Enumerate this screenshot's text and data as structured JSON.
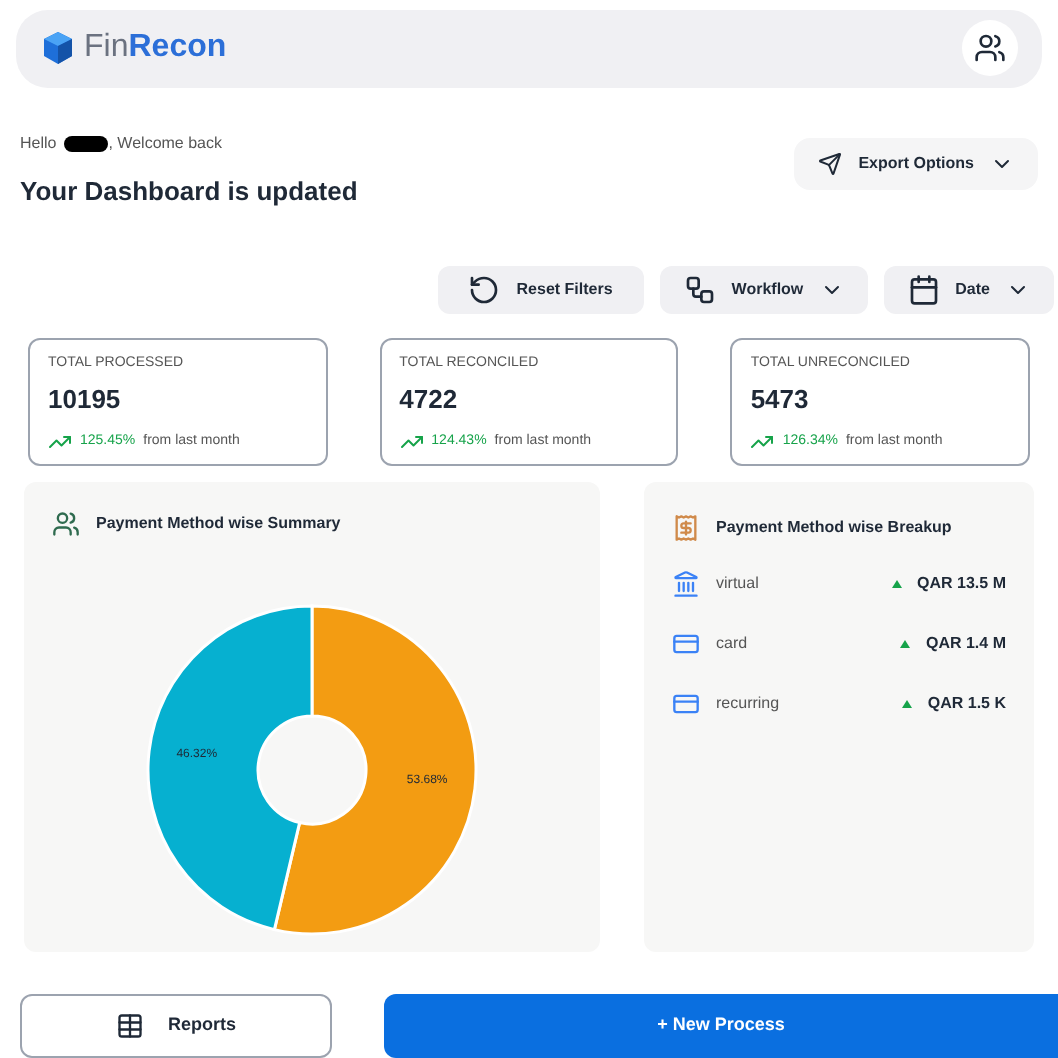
{
  "header": {
    "logo_prefix": "Fin",
    "logo_suffix": "Recon"
  },
  "greeting": {
    "prefix": "Hello",
    "suffix": ", Welcome back",
    "title": "Your Dashboard is updated"
  },
  "export_button": {
    "label": "Export Options"
  },
  "filters": [
    {
      "kind": "reset",
      "label": "Reset Filters"
    },
    {
      "kind": "workflow",
      "label": "Workflow"
    },
    {
      "kind": "date",
      "label": "Date"
    }
  ],
  "stats": [
    {
      "label": "TOTAL PROCESSED",
      "value": "10195",
      "change": "125.45%",
      "suffix": "from last month"
    },
    {
      "label": "TOTAL RECONCILED",
      "value": "4722",
      "change": "124.43%",
      "suffix": "from last month"
    },
    {
      "label": "TOTAL UNRECONCILED",
      "value": "5473",
      "change": "126.34%",
      "suffix": "from last month"
    }
  ],
  "summary": {
    "title": "Payment Method wise Summary",
    "chart_data": {
      "type": "donut",
      "values": [
        53.68,
        46.32
      ],
      "value_labels": [
        "53.68%",
        "46.32%"
      ],
      "colors": [
        "#f39c12",
        "#06b0d0"
      ]
    }
  },
  "breakup": {
    "title": "Payment Method wise Breakup",
    "items": [
      {
        "kind": "bank",
        "name": "virtual",
        "amount": "QAR 13.5 M"
      },
      {
        "kind": "card",
        "name": "card",
        "amount": "QAR 1.4 M"
      },
      {
        "kind": "card",
        "name": "recurring",
        "amount": "QAR 1.5 K"
      }
    ]
  },
  "actions": {
    "reports": "Reports",
    "new_process": "+ New Process"
  }
}
